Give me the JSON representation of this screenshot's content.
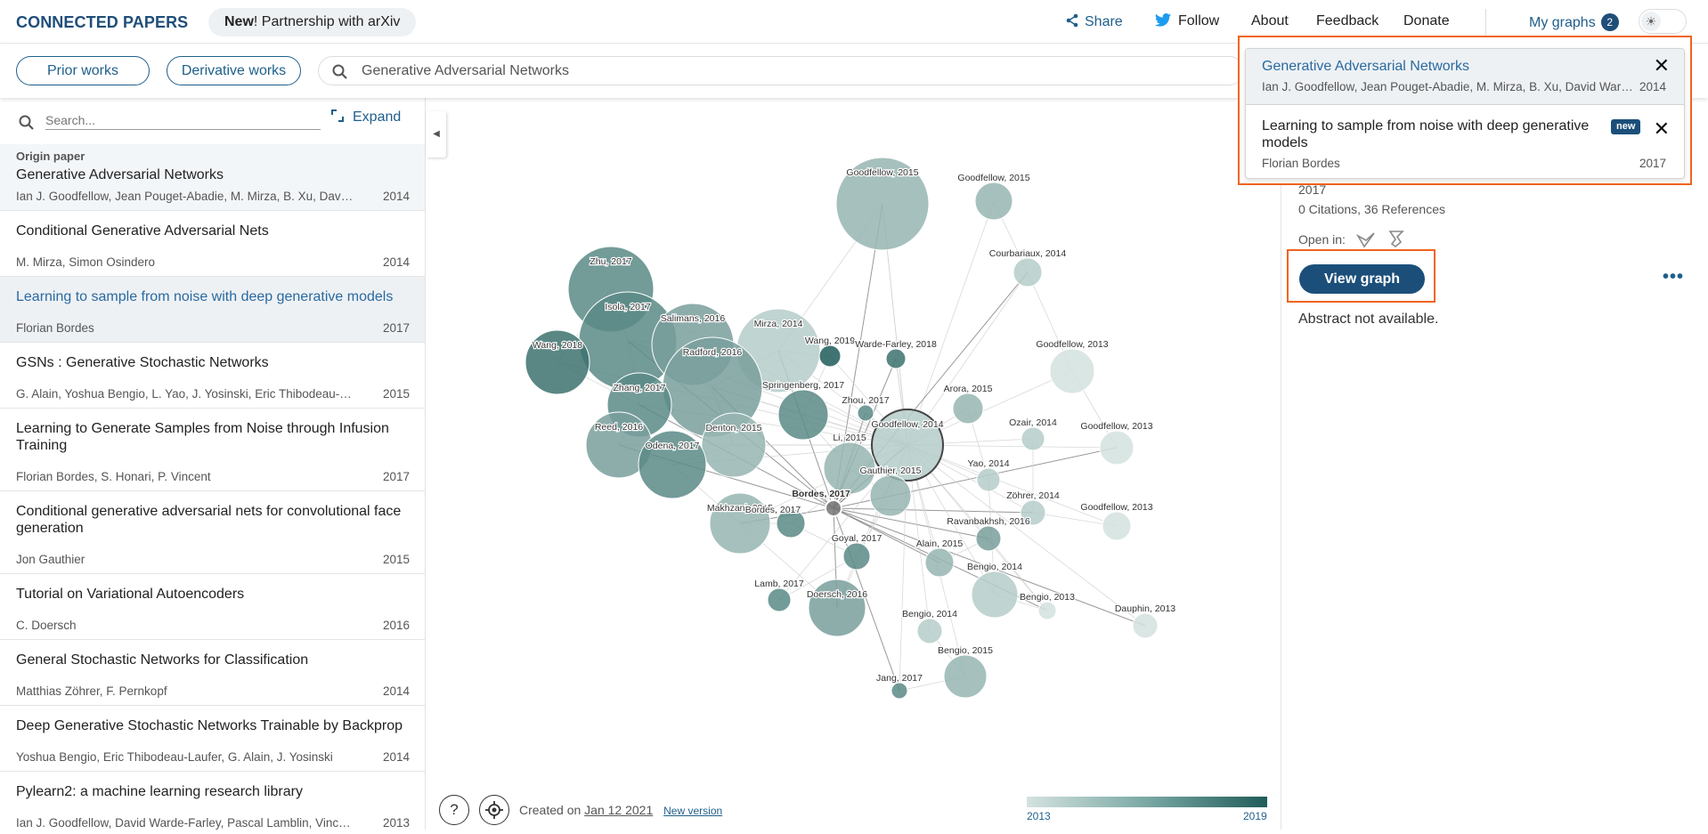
{
  "header": {
    "brand": "CONNECTED PAPERS",
    "news_bold": "New",
    "news_text": "! Partnership with arXiv",
    "share": "Share",
    "follow": "Follow",
    "about": "About",
    "feedback": "Feedback",
    "donate": "Donate",
    "my_graphs": "My graphs",
    "my_graphs_count": "2"
  },
  "toolbar": {
    "prior_works": "Prior works",
    "derivative_works": "Derivative works",
    "search_value": "Generative Adversarial Networks"
  },
  "left_panel": {
    "search_placeholder": "Search...",
    "expand": "Expand",
    "origin_label": "Origin paper",
    "papers": [
      {
        "title": "Generative Adversarial Networks",
        "authors": "Ian J. Goodfellow, Jean Pouget-Abadie, M. Mirza, B. Xu, David Warde-Farley, Sherjil Ozair, Aaron C. Courville, Yoshua Bengio",
        "year": "2014"
      },
      {
        "title": "Conditional Generative Adversarial Nets",
        "authors": "M. Mirza, Simon Osindero",
        "year": "2014"
      },
      {
        "title": "Learning to sample from noise with deep generative models",
        "authors": "Florian Bordes",
        "year": "2017"
      },
      {
        "title": "GSNs : Generative Stochastic Networks",
        "authors": "G. Alain, Yoshua Bengio, L. Yao, J. Yosinski, Eric Thibodeau-Laufer, Saizheng Zhang, P. Vincent",
        "year": "2015"
      },
      {
        "title": "Learning to Generate Samples from Noise through Infusion Training",
        "authors": "Florian Bordes, S. Honari, P. Vincent",
        "year": "2017"
      },
      {
        "title": "Conditional generative adversarial nets for convolutional face generation",
        "authors": "Jon Gauthier",
        "year": "2015"
      },
      {
        "title": "Tutorial on Variational Autoencoders",
        "authors": "C. Doersch",
        "year": "2016"
      },
      {
        "title": "General Stochastic Networks for Classification",
        "authors": "Matthias Zöhrer, F. Pernkopf",
        "year": "2014"
      },
      {
        "title": "Deep Generative Stochastic Networks Trainable by Backprop",
        "authors": "Yoshua Bengio, Eric Thibodeau-Laufer, G. Alain, J. Yosinski",
        "year": "2014"
      },
      {
        "title": "Pylearn2: a machine learning research library",
        "authors": "Ian J. Goodfellow, David Warde-Farley, Pascal Lamblin, Vincent Dumoulin, Mehdi Mirza, Razvan Pascanu",
        "year": "2013"
      }
    ]
  },
  "graph": {
    "nodes": [
      {
        "label": "Goodfellow, 2015",
        "year": 2015
      },
      {
        "label": "Goodfellow, 2015",
        "year": 2015
      },
      {
        "label": "Courbariaux, 2014",
        "year": 2014
      },
      {
        "label": "Zhu, 2017",
        "year": 2017
      },
      {
        "label": "Isola, 2017",
        "year": 2017
      },
      {
        "label": "Salimans, 2016",
        "year": 2016
      },
      {
        "label": "Mirza, 2014",
        "year": 2014
      },
      {
        "label": "Wang, 2019",
        "year": 2019
      },
      {
        "label": "Warde-Farley, 2018",
        "year": 2018
      },
      {
        "label": "Wang, 2018",
        "year": 2018
      },
      {
        "label": "Radford, 2016",
        "year": 2016
      },
      {
        "label": "Goodfellow, 2013",
        "year": 2013
      },
      {
        "label": "Zhang, 2017",
        "year": 2017
      },
      {
        "label": "Springenberg, 2017",
        "year": 2017
      },
      {
        "label": "Zhou, 2017",
        "year": 2017
      },
      {
        "label": "Arora, 2015",
        "year": 2015
      },
      {
        "label": "Reed, 2016",
        "year": 2016
      },
      {
        "label": "Denton, 2015",
        "year": 2015
      },
      {
        "label": "Goodfellow, 2014",
        "year": 2014
      },
      {
        "label": "Ozair, 2014",
        "year": 2014
      },
      {
        "label": "Goodfellow, 2013",
        "year": 2013
      },
      {
        "label": "Odena, 2017",
        "year": 2017
      },
      {
        "label": "Li, 2015",
        "year": 2015
      },
      {
        "label": "Yao, 2014",
        "year": 2014
      },
      {
        "label": "Bordes, 2017",
        "year": 2017
      },
      {
        "label": "Gauthier, 2015",
        "year": 2015
      },
      {
        "label": "Zöhrer, 2014",
        "year": 2014
      },
      {
        "label": "Goodfellow, 2013",
        "year": 2013
      },
      {
        "label": "Makhzani, 2015",
        "year": 2015
      },
      {
        "label": "Bordes, 2017",
        "year": 2017
      },
      {
        "label": "Ravanbakhsh, 2016",
        "year": 2016
      },
      {
        "label": "Goyal, 2017",
        "year": 2017
      },
      {
        "label": "Alain, 2015",
        "year": 2015
      },
      {
        "label": "Bengio, 2014",
        "year": 2014
      },
      {
        "label": "Bengio, 2013",
        "year": 2013
      },
      {
        "label": "Lamb, 2017",
        "year": 2017
      },
      {
        "label": "Doersch, 2016",
        "year": 2016
      },
      {
        "label": "Bengio, 2014",
        "year": 2014
      },
      {
        "label": "Dauphin, 2013",
        "year": 2013
      },
      {
        "label": "Bengio, 2015",
        "year": 2015
      },
      {
        "label": "Jang, 2017",
        "year": 2017
      }
    ],
    "created_prefix": "Created on",
    "created_date": "Jan 12 2021",
    "new_version": "New version",
    "legend_min": "2013",
    "legend_max": "2019"
  },
  "right_panel": {
    "year": "2017",
    "citations": "0 Citations, 36 References",
    "open_in": "Open in:",
    "view_graph": "View graph",
    "abstract": "Abstract not available."
  },
  "dropdown": {
    "items": [
      {
        "title": "Generative Adversarial Networks",
        "authors": "Ian J. Goodfellow, Jean Pouget-Abadie, M. Mirza, B. Xu, David Warde-Farley, Sherjil Ozair, Aaron C. Courville, Yoshua Bengio",
        "year": "2014"
      },
      {
        "title": "Learning to sample from noise with deep generative models",
        "authors": "Florian Bordes",
        "year": "2017",
        "badge": "new"
      }
    ]
  },
  "colors": {
    "brand": "#1f4e79",
    "accent": "#1f5f8b",
    "highlight_outline": "#f0641d",
    "node_old": "#d3e2df",
    "node_new": "#1f5c59"
  }
}
